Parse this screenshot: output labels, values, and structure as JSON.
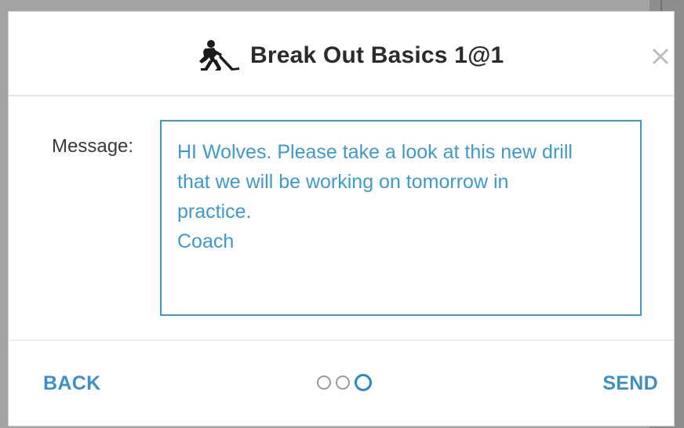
{
  "modal": {
    "title": "Break Out Basics 1@1",
    "title_icon": "hockey-player-icon",
    "close_icon": "close-icon"
  },
  "form": {
    "message_label": "Message:",
    "message_value": "HI Wolves. Please take a look at this new drill\nthat we will be working on tomorrow in\npractice.\nCoach"
  },
  "footer": {
    "back_label": "BACK",
    "send_label": "SEND",
    "steps": {
      "total": 3,
      "current": 3
    }
  },
  "colors": {
    "accent": "#3d8fc7",
    "message_text": "#3d9ad1",
    "title_text": "#2b2b2b",
    "inactive_dot": "#9a9a9a"
  }
}
